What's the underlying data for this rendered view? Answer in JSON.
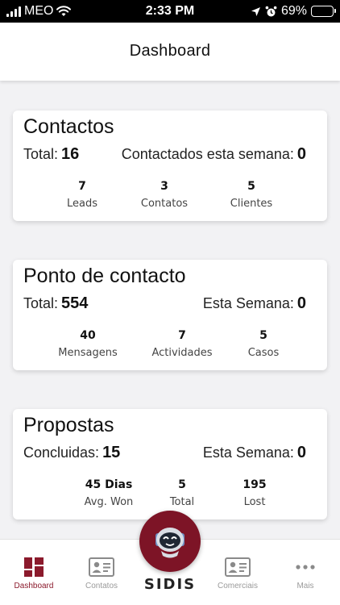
{
  "status_bar": {
    "carrier": "MEO",
    "time": "2:33 PM",
    "battery": "69%",
    "battery_level": 0.69
  },
  "header": {
    "title": "Dashboard"
  },
  "cards": {
    "contactos": {
      "title": "Contactos",
      "total_label": "Total:",
      "total_value": "16",
      "week_label": "Contactados esta semana:",
      "week_value": "0",
      "stats": [
        {
          "value": "7",
          "label": "Leads"
        },
        {
          "value": "3",
          "label": "Contatos"
        },
        {
          "value": "5",
          "label": "Clientes"
        }
      ]
    },
    "ponto": {
      "title": "Ponto de contacto",
      "total_label": "Total:",
      "total_value": "554",
      "week_label": "Esta Semana:",
      "week_value": "0",
      "stats": [
        {
          "value": "40",
          "label": "Mensagens"
        },
        {
          "value": "7",
          "label": "Actividades"
        },
        {
          "value": "5",
          "label": "Casos"
        }
      ]
    },
    "propostas": {
      "title": "Propostas",
      "total_label": "Concluidas:",
      "total_value": "15",
      "week_label": "Esta Semana:",
      "week_value": "0",
      "stats": [
        {
          "value": "45 Dias",
          "label": "Avg. Won"
        },
        {
          "value": "5",
          "label": "Total"
        },
        {
          "value": "195",
          "label": "Lost"
        }
      ]
    }
  },
  "tabbar": {
    "items": [
      {
        "label": "Dashboard",
        "icon": "dashboard-icon"
      },
      {
        "label": "Contatos",
        "icon": "contact-card-icon"
      },
      {
        "label": "Comerciais",
        "icon": "contact-card-icon"
      },
      {
        "label": "Mais",
        "icon": "more-icon"
      }
    ],
    "center_logo": "SIDIS"
  },
  "colors": {
    "accent": "#8b1a2c",
    "center_button": "#7d1426",
    "inactive": "#9a9a9a"
  }
}
